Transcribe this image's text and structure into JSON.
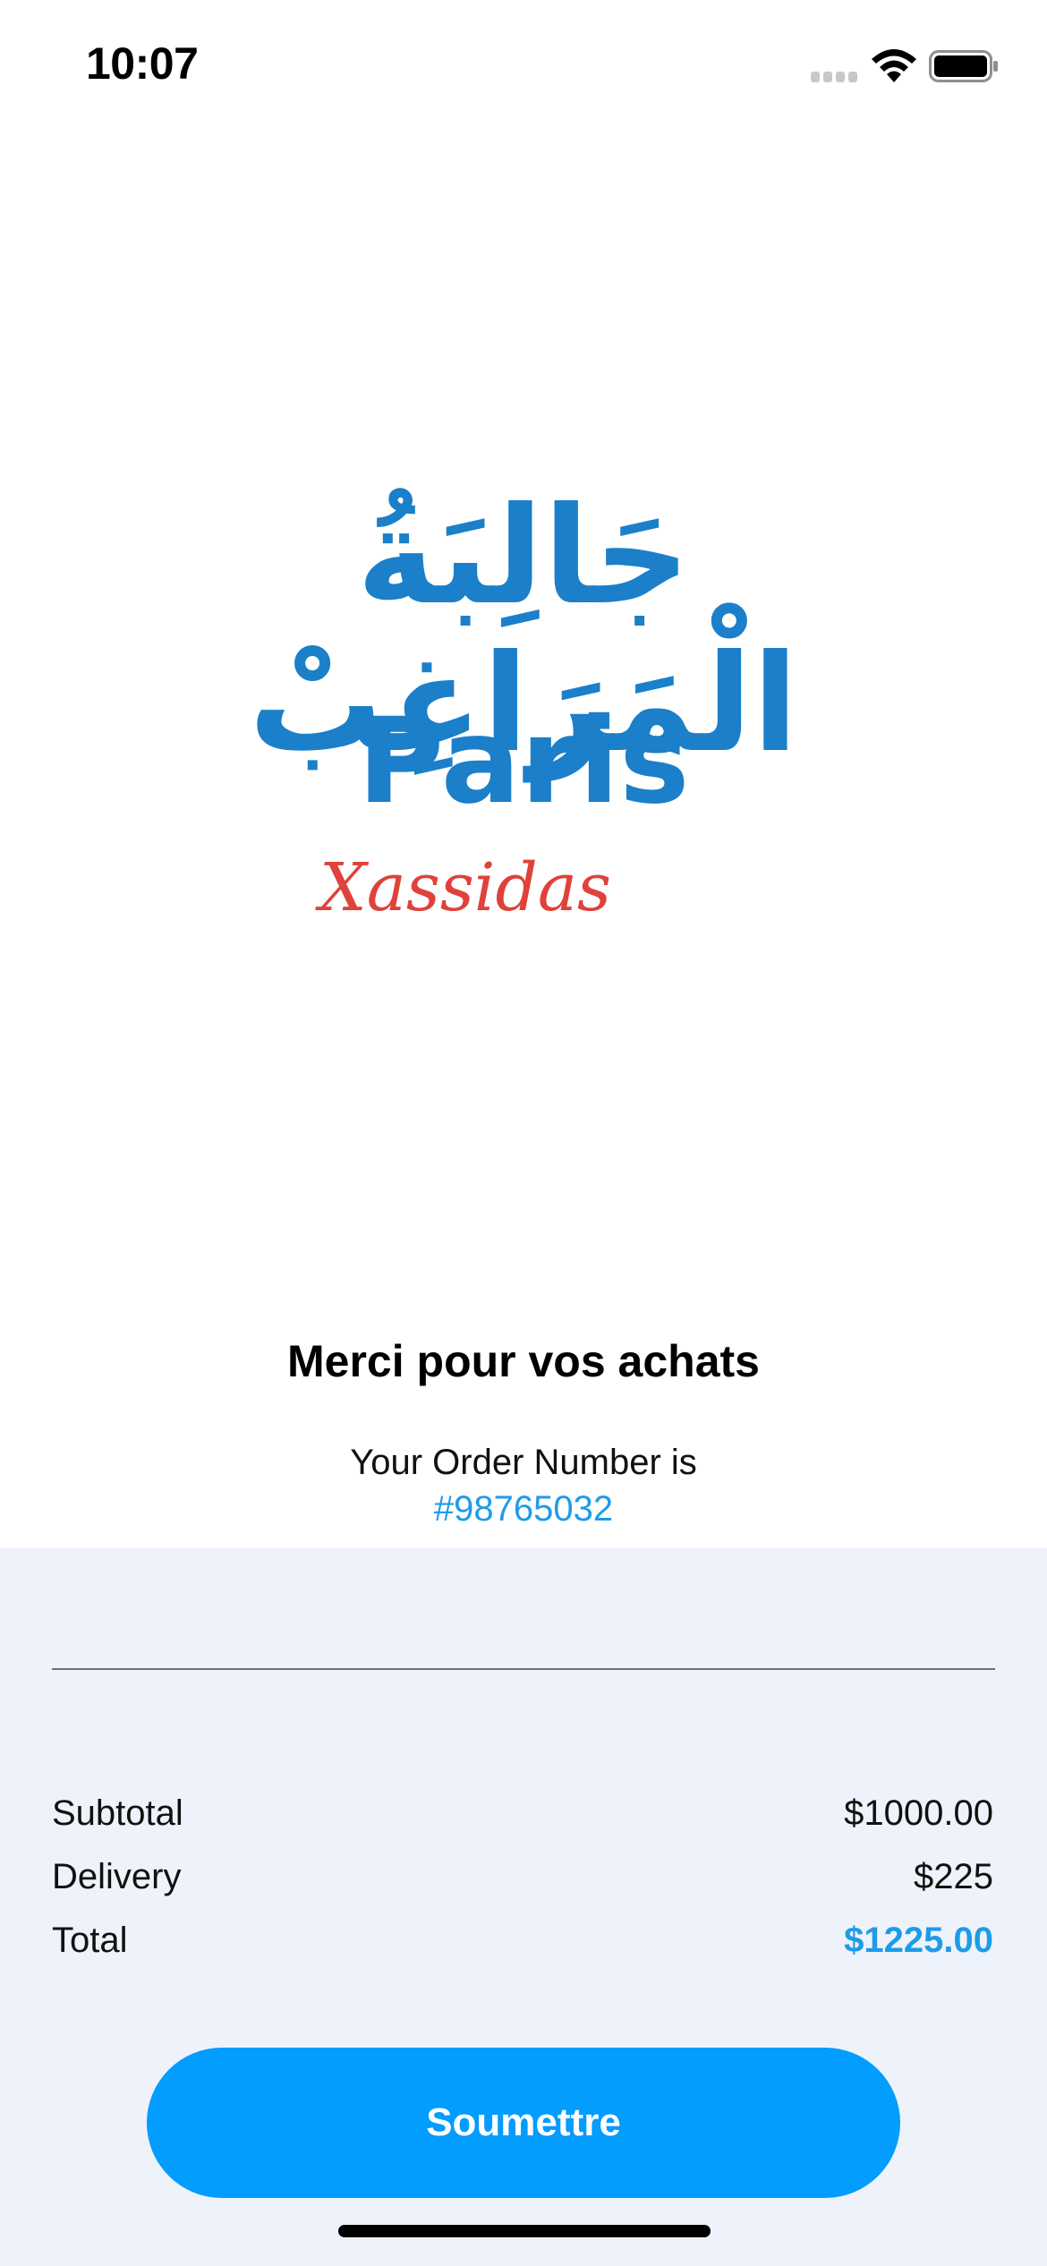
{
  "status_bar": {
    "time": "10:07",
    "signal_icon": "cellular-signal-icon",
    "wifi_icon": "wifi-icon",
    "battery_icon": "battery-icon"
  },
  "logo": {
    "arabic_text": "جَالِبَةُ الْمَرَاغِبْ",
    "title": "Paris",
    "subtitle": "Xassidas",
    "colors": {
      "primary": "#1b7fc9",
      "accent": "#e0413a"
    }
  },
  "confirmation": {
    "title": "Merci pour vos achats",
    "order_label": "Your Order Number is",
    "order_number": "#98765032"
  },
  "summary": {
    "subtotal_label": "Subtotal",
    "subtotal_value": "$1000.00",
    "delivery_label": "Delivery",
    "delivery_value": "$225",
    "total_label": "Total",
    "total_value": "$1225.00"
  },
  "actions": {
    "submit_label": "Soumettre"
  },
  "colors": {
    "accent": "#039cff",
    "link": "#1e9be8",
    "panel_background": "#eef3fb"
  }
}
